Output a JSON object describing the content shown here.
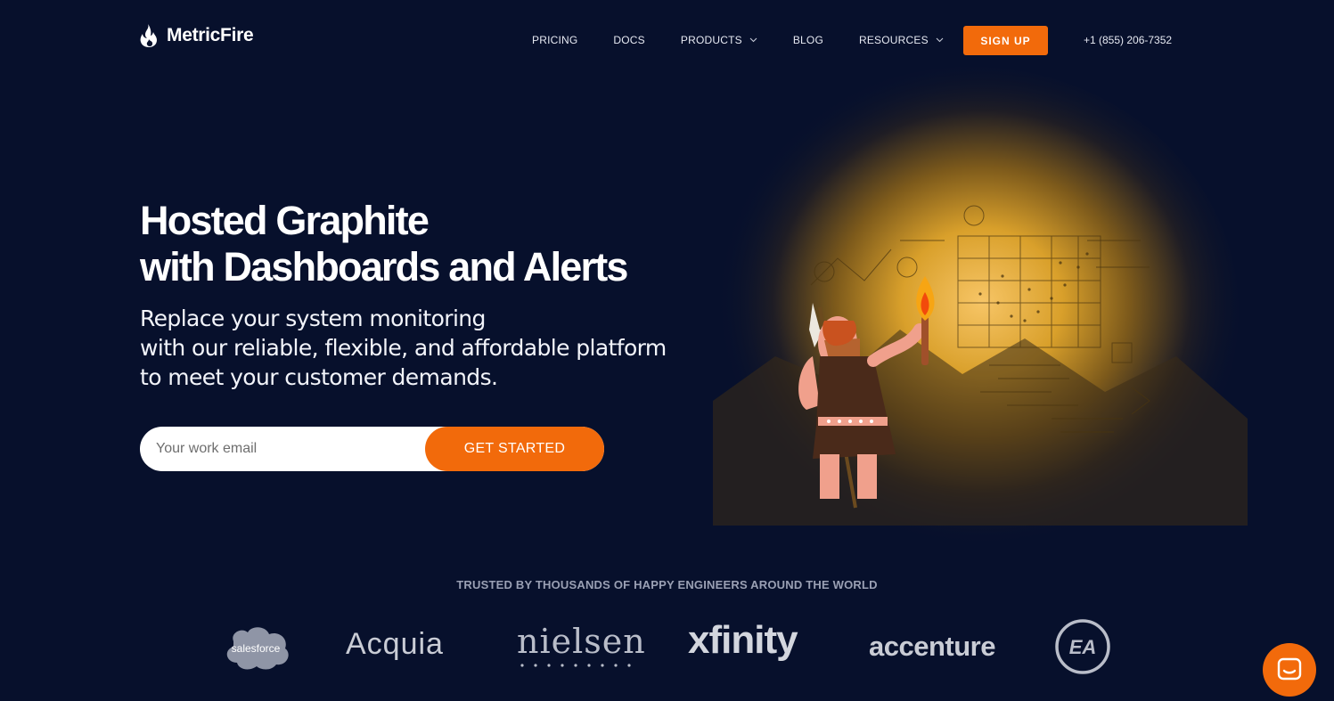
{
  "brand": {
    "name": "MetricFire",
    "accent": "#f26a0b",
    "background": "#07102c"
  },
  "nav": {
    "links": [
      {
        "label": "PRICING"
      },
      {
        "label": "DOCS"
      },
      {
        "label": "PRODUCTS",
        "dropdown": true
      },
      {
        "label": "BLOG"
      },
      {
        "label": "RESOURCES",
        "dropdown": true
      }
    ],
    "signup_label": "SIGN UP",
    "phone": "+1 (855) 206-7352"
  },
  "hero": {
    "title_line1": "Hosted Graphite",
    "title_line2": "with Dashboards and Alerts",
    "sub_line1": "Replace your system monitoring",
    "sub_line2": "with our reliable, flexible, and affordable platform",
    "sub_line3": "to meet your customer demands.",
    "email_placeholder": "Your work email",
    "cta_label": "GET STARTED"
  },
  "trusted": {
    "heading": "TRUSTED BY THOUSANDS OF HAPPY ENGINEERS AROUND THE WORLD",
    "logos": [
      "salesforce",
      "Acquia",
      "nielsen",
      "xfinity",
      "accenture",
      "EA"
    ]
  },
  "chat": {
    "icon": "chat-icon"
  }
}
